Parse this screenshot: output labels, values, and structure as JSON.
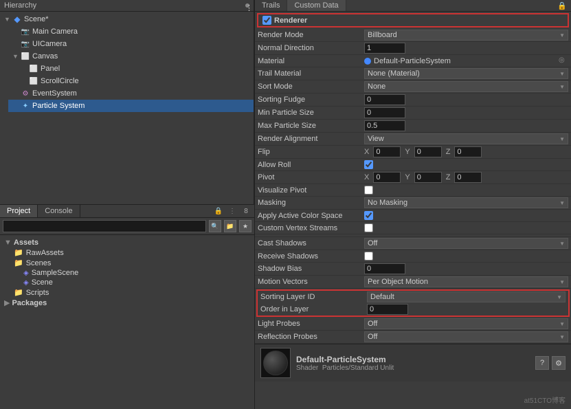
{
  "hierarchy": {
    "title": "Hierarchy",
    "scene_name": "Scene*",
    "items": [
      {
        "label": "Main Camera",
        "indent": 1,
        "icon": "camera",
        "arrow": ""
      },
      {
        "label": "UICamera",
        "indent": 1,
        "icon": "camera",
        "arrow": ""
      },
      {
        "label": "Canvas",
        "indent": 1,
        "icon": "canvas",
        "arrow": "▼"
      },
      {
        "label": "Panel",
        "indent": 2,
        "icon": "obj",
        "arrow": ""
      },
      {
        "label": "ScrollCircle",
        "indent": 2,
        "icon": "obj",
        "arrow": ""
      },
      {
        "label": "EventSystem",
        "indent": 1,
        "icon": "event",
        "arrow": ""
      },
      {
        "label": "Particle System",
        "indent": 1,
        "icon": "particle",
        "arrow": "",
        "selected": true
      }
    ]
  },
  "project": {
    "tab_project": "Project",
    "tab_console": "Console",
    "search_placeholder": "",
    "folders": [
      {
        "label": "Assets",
        "type": "root"
      },
      {
        "label": "RawAssets",
        "type": "folder",
        "indent": 1
      },
      {
        "label": "Scenes",
        "type": "folder",
        "indent": 1
      },
      {
        "label": "SampleScene",
        "type": "scene",
        "indent": 2
      },
      {
        "label": "Scene",
        "type": "scene",
        "indent": 2
      },
      {
        "label": "Scripts",
        "type": "folder",
        "indent": 1
      },
      {
        "label": "Packages",
        "type": "root"
      }
    ],
    "badge": "8"
  },
  "inspector": {
    "tabs": [
      {
        "label": "Trails"
      },
      {
        "label": "Custom Data"
      }
    ],
    "renderer_label": "Renderer",
    "renderer_checked": true,
    "rows": [
      {
        "label": "Render Mode",
        "type": "dropdown",
        "value": "Billboard"
      },
      {
        "label": "Normal Direction",
        "type": "text",
        "value": "1"
      },
      {
        "label": "Material",
        "type": "material",
        "value": "Default-ParticleSystem"
      },
      {
        "label": "Trail Material",
        "type": "dropdown",
        "value": "None (Material)"
      },
      {
        "label": "Sort Mode",
        "type": "dropdown",
        "value": "None"
      },
      {
        "label": "Sorting Fudge",
        "type": "text",
        "value": "0"
      },
      {
        "label": "Min Particle Size",
        "type": "text",
        "value": "0"
      },
      {
        "label": "Max Particle Size",
        "type": "text",
        "value": "0.5"
      },
      {
        "label": "Render Alignment",
        "type": "dropdown",
        "value": "View"
      },
      {
        "label": "Flip",
        "type": "xyz",
        "x": "0",
        "y": "0",
        "z": "0"
      },
      {
        "label": "Allow Roll",
        "type": "checkbox",
        "checked": true
      },
      {
        "label": "Pivot",
        "type": "xyz",
        "x": "0",
        "y": "0",
        "z": "0"
      },
      {
        "label": "Visualize Pivot",
        "type": "checkbox",
        "checked": false
      },
      {
        "label": "Masking",
        "type": "dropdown",
        "value": "No Masking"
      },
      {
        "label": "Apply Active Color Space",
        "type": "checkbox",
        "checked": true
      },
      {
        "label": "Custom Vertex Streams",
        "type": "checkbox",
        "checked": false
      },
      {
        "label": "",
        "type": "spacer"
      },
      {
        "label": "Cast Shadows",
        "type": "dropdown",
        "value": "Off"
      },
      {
        "label": "Receive Shadows",
        "type": "checkbox",
        "checked": false
      },
      {
        "label": "Shadow Bias",
        "type": "text",
        "value": "0"
      },
      {
        "label": "Motion Vectors",
        "type": "dropdown",
        "value": "Per Object Motion"
      },
      {
        "label": "Sorting Layer ID",
        "type": "dropdown_highlight",
        "value": "Default"
      },
      {
        "label": "Order in Layer",
        "type": "text_highlight",
        "value": "0"
      },
      {
        "label": "Light Probes",
        "type": "dropdown",
        "value": "Off"
      },
      {
        "label": "Reflection Probes",
        "type": "dropdown",
        "value": "Off"
      }
    ],
    "bottom_material": "Default-ParticleSystem",
    "bottom_shader": "Particles/Standard Unlit",
    "help_icon": "?",
    "settings_icon": "⚙"
  },
  "watermark": "at51CTO博客"
}
